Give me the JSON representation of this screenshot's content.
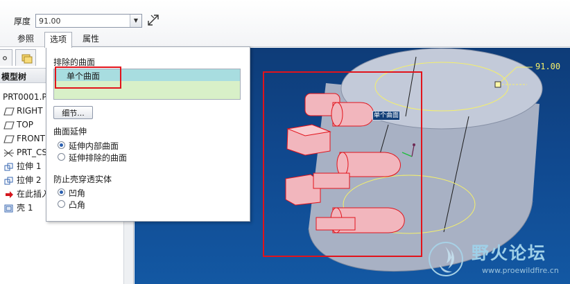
{
  "dashboard": {
    "thickness_label": "厚度",
    "thickness_value": "91.00",
    "tabs": [
      {
        "label": "参照",
        "active": false
      },
      {
        "label": "选项",
        "active": true
      },
      {
        "label": "属性",
        "active": false
      }
    ]
  },
  "model_tree": {
    "title": "模型树",
    "items": [
      {
        "label": "PRT0001.P",
        "icon": "part-icon"
      },
      {
        "label": "RIGHT",
        "icon": "datum-plane-icon"
      },
      {
        "label": "TOP",
        "icon": "datum-plane-icon"
      },
      {
        "label": "FRONT",
        "icon": "datum-plane-icon"
      },
      {
        "label": "PRT_CS",
        "icon": "csys-icon"
      },
      {
        "label": "拉伸 1",
        "icon": "extrude-icon"
      },
      {
        "label": "拉伸 2",
        "icon": "extrude-icon"
      },
      {
        "label": "在此插入",
        "icon": "insert-arrow-icon"
      },
      {
        "label": "壳 1",
        "icon": "shell-icon"
      }
    ]
  },
  "options_panel": {
    "excluded_surfaces_label": "排除的曲面",
    "excluded_item": "单个曲面",
    "detail_button": "细节...",
    "surface_extension_label": "曲面延伸",
    "extension_options": [
      {
        "label": "延伸内部曲面",
        "selected": true
      },
      {
        "label": "延伸排除的曲面",
        "selected": false
      }
    ],
    "prevent_label": "防止壳穿透实体",
    "corner_options": [
      {
        "label": "凹角",
        "selected": true
      },
      {
        "label": "凸角",
        "selected": false
      }
    ]
  },
  "viewport": {
    "dimension_value": "91.00",
    "surface_tag": "单个曲面"
  },
  "watermark": {
    "title": "野火论坛",
    "url": "www.proewildfire.cn"
  },
  "colors": {
    "viewport_bg": "#10488e",
    "model_gray": "#a7b0c3",
    "selection_red": "#e2131b",
    "surface_pink": "#f2b6bd",
    "dimension_yellow": "#f5f06a"
  }
}
